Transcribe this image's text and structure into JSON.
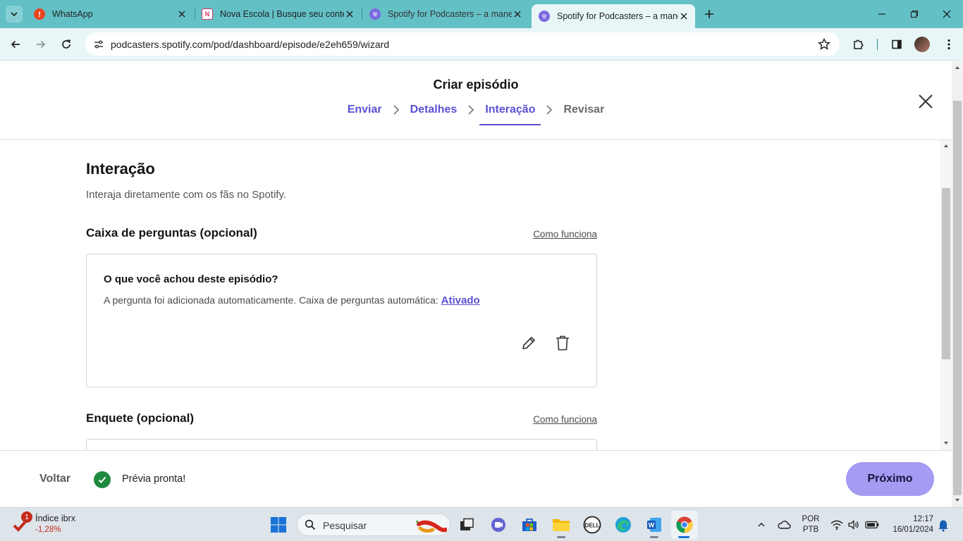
{
  "browser": {
    "tabs": [
      {
        "title": "WhatsApp",
        "icon": "whatsapp-alert-icon"
      },
      {
        "title": "Nova Escola | Busque seu conte",
        "icon": "nova-escola-icon"
      },
      {
        "title": "Spotify for Podcasters – a mane",
        "icon": "spotify-podcasters-icon"
      },
      {
        "title": "Spotify for Podcasters – a mane",
        "icon": "spotify-podcasters-icon",
        "active": true
      }
    ],
    "url": "podcasters.spotify.com/pod/dashboard/episode/e2eh659/wizard"
  },
  "wizard": {
    "title": "Criar episódio",
    "steps": [
      {
        "label": "Enviar",
        "state": "done"
      },
      {
        "label": "Detalhes",
        "state": "done"
      },
      {
        "label": "Interação",
        "state": "current"
      },
      {
        "label": "Revisar",
        "state": "upcoming"
      }
    ]
  },
  "content": {
    "heading": "Interação",
    "subtitle": "Interaja diretamente com os fãs no Spotify.",
    "questions": {
      "title": "Caixa de perguntas (opcional)",
      "how_link": "Como funciona",
      "card": {
        "question": "O que você achou deste episódio?",
        "note": "A pergunta foi adicionada automaticamente. Caixa de perguntas automática:",
        "status_link": "Ativado"
      }
    },
    "poll": {
      "title": "Enquete (opcional)",
      "how_link": "Como funciona"
    }
  },
  "footer": {
    "back": "Voltar",
    "status": "Prévia pronta!",
    "next": "Próximo"
  },
  "taskbar": {
    "stock_name": "Índice ibrx",
    "stock_change": "-1,28%",
    "stock_badge": "1",
    "search_placeholder": "Pesquisar",
    "lang_line1": "POR",
    "lang_line2": "PTB",
    "time": "12:17",
    "date": "16/01/2024"
  },
  "colors": {
    "accent": "#5b51d4",
    "next_button": "#a49bf2",
    "tabstrip": "#63c1c6",
    "success": "#1e8a3f"
  }
}
